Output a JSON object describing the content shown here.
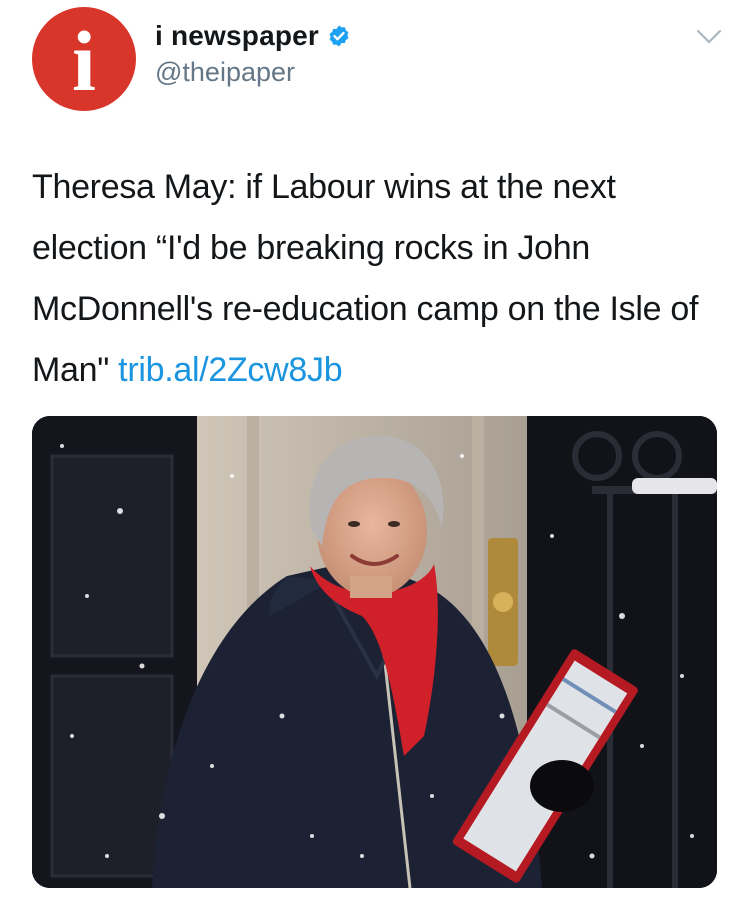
{
  "account": {
    "avatar_letter": "i",
    "display_name": "i newspaper",
    "handle": "@theipaper",
    "verified_icon": "verified-badge-icon",
    "menu_icon": "chevron-down-icon"
  },
  "tweet": {
    "text": "Theresa May: if Labour wins at the next election “I'd be breaking rocks in John McDonnell's re-education camp on the Isle of Man\" ",
    "link": "trib.al/2Zcw8Jb"
  },
  "photo": {
    "icon": "photo-image"
  },
  "colors": {
    "avatar_bg": "#d9362b",
    "link": "#1b95e0",
    "verified": "#1da1f2",
    "text": "#14171a",
    "secondary": "#657786"
  }
}
